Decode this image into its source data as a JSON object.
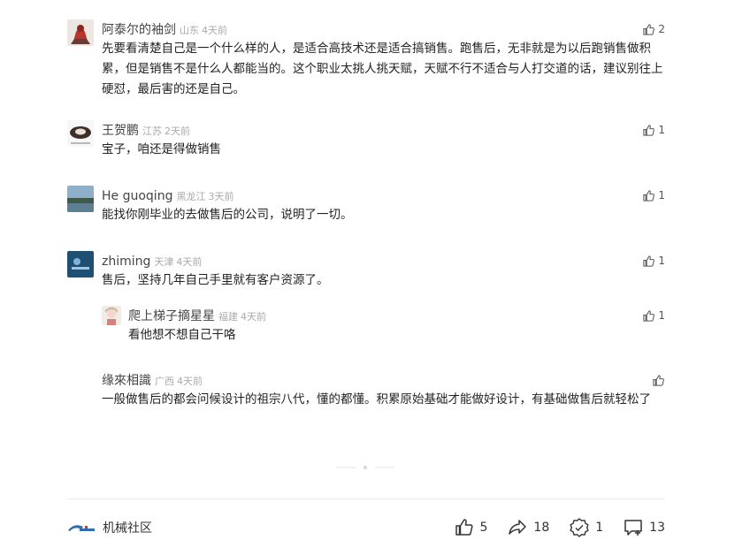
{
  "comments": [
    {
      "name": "阿泰尔的袖剑",
      "region": "山东",
      "time": "4天前",
      "text": "先要看清楚自己是一个什么样的人，是适合高技术还是适合搞销售。跑售后，无非就是为以后跑销售做积累，但是销售不是什么人都能当的。这个职业太挑人挑天赋，天赋不行不适合与人打交道的话，建议别往上硬怼，最后害的还是自己。",
      "likes": "2"
    },
    {
      "name": "王贺鹏",
      "region": "江苏",
      "time": "2天前",
      "text": "宝子，咱还是得做销售",
      "likes": "1"
    },
    {
      "name": "He guoqing",
      "region": "黑龙江",
      "time": "3天前",
      "text": "能找你刚毕业的去做售后的公司，说明了一切。",
      "likes": "1"
    },
    {
      "name": "zhiming",
      "region": "天津",
      "time": "4天前",
      "text": "售后，坚持几年自己手里就有客户资源了。",
      "likes": "1"
    },
    {
      "name": "爬上梯子摘星星",
      "region": "福建",
      "time": "4天前",
      "text": "看他想不想自己干咯",
      "likes": "1"
    },
    {
      "name": "缘來相識",
      "region": "广西",
      "time": "4天前",
      "text": "一般做售后的都会问候设计的祖宗八代，懂的都懂。积累原始基础才能做好设计，有基础做售后就轻松了",
      "likes": ""
    }
  ],
  "footer": {
    "brand_name": "机械社区",
    "likes": "5",
    "shares": "18",
    "favorites": "1",
    "comments": "13"
  },
  "icons": {
    "like": "thumbs-up-icon",
    "share": "share-arrow-icon",
    "favorite": "badge-icon",
    "comment": "comment-plus-icon"
  }
}
